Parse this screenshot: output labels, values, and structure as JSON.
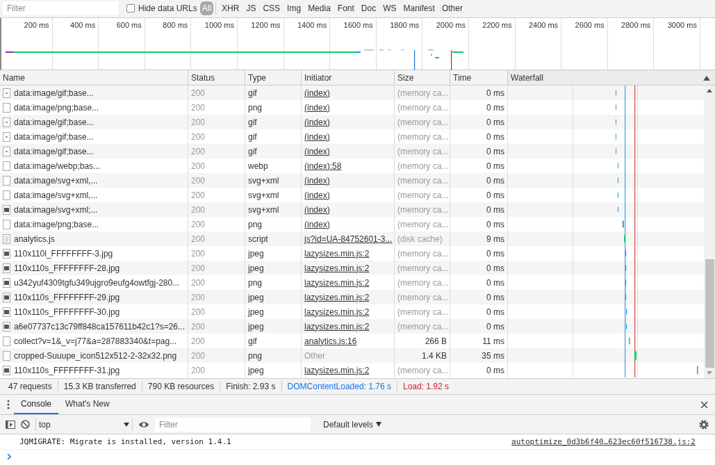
{
  "filter_bar": {
    "placeholder": "Filter",
    "hide_data_urls": {
      "label": "Hide data URLs",
      "checked": false
    },
    "type_filters": [
      {
        "label": "All",
        "selected": true
      },
      {
        "label": "XHR",
        "selected": false
      },
      {
        "label": "JS",
        "selected": false
      },
      {
        "label": "CSS",
        "selected": false
      },
      {
        "label": "Img",
        "selected": false
      },
      {
        "label": "Media",
        "selected": false
      },
      {
        "label": "Font",
        "selected": false
      },
      {
        "label": "Doc",
        "selected": false
      },
      {
        "label": "WS",
        "selected": false
      },
      {
        "label": "Manifest",
        "selected": false
      },
      {
        "label": "Other",
        "selected": false
      }
    ]
  },
  "overview": {
    "ticks": [
      "200 ms",
      "400 ms",
      "600 ms",
      "800 ms",
      "1000 ms",
      "1200 ms",
      "1400 ms",
      "1600 ms",
      "1800 ms",
      "2000 ms",
      "2200 ms",
      "2400 ms",
      "2600 ms",
      "2800 ms",
      "3000 ms"
    ]
  },
  "table": {
    "columns": [
      {
        "label": "Name",
        "sorted": false
      },
      {
        "label": "Status",
        "sorted": false
      },
      {
        "label": "Type",
        "sorted": false
      },
      {
        "label": "Initiator",
        "sorted": false
      },
      {
        "label": "Size",
        "sorted": false
      },
      {
        "label": "Time",
        "sorted": false
      },
      {
        "label": "Waterfall",
        "sorted": true
      }
    ],
    "rows": [
      {
        "kind": "dot",
        "name": "data:image/gif;base...",
        "status": "200",
        "type": "gif",
        "initiator": "(index)",
        "initiator_link": true,
        "size": "(memory ca...",
        "size_cached": true,
        "time": "0 ms"
      },
      {
        "kind": "blank",
        "name": "data:image/png;base...",
        "status": "200",
        "type": "png",
        "initiator": "(index)",
        "initiator_link": true,
        "size": "(memory ca...",
        "size_cached": true,
        "time": "0 ms"
      },
      {
        "kind": "dot",
        "name": "data:image/gif;base...",
        "status": "200",
        "type": "gif",
        "initiator": "(index)",
        "initiator_link": true,
        "size": "(memory ca...",
        "size_cached": true,
        "time": "0 ms"
      },
      {
        "kind": "dot",
        "name": "data:image/gif;base...",
        "status": "200",
        "type": "gif",
        "initiator": "(index)",
        "initiator_link": true,
        "size": "(memory ca...",
        "size_cached": true,
        "time": "0 ms"
      },
      {
        "kind": "dot",
        "name": "data:image/gif;base...",
        "status": "200",
        "type": "gif",
        "initiator": "(index)",
        "initiator_link": true,
        "size": "(memory ca...",
        "size_cached": true,
        "time": "0 ms"
      },
      {
        "kind": "blank",
        "name": "data:image/webp;bas...",
        "status": "200",
        "type": "webp",
        "initiator": "(index):58",
        "initiator_link": true,
        "size": "(memory ca...",
        "size_cached": true,
        "time": "0 ms"
      },
      {
        "kind": "blank",
        "name": "data:image/svg+xml,...",
        "status": "200",
        "type": "svg+xml",
        "initiator": "(index)",
        "initiator_link": true,
        "size": "(memory ca...",
        "size_cached": true,
        "time": "0 ms"
      },
      {
        "kind": "blank",
        "name": "data:image/svg+xml,...",
        "status": "200",
        "type": "svg+xml",
        "initiator": "(index)",
        "initiator_link": true,
        "size": "(memory ca...",
        "size_cached": true,
        "time": "0 ms"
      },
      {
        "kind": "thumb",
        "name": "data:image/svg+xml;...",
        "status": "200",
        "type": "svg+xml",
        "initiator": "(index)",
        "initiator_link": true,
        "size": "(memory ca...",
        "size_cached": true,
        "time": "0 ms"
      },
      {
        "kind": "blank",
        "name": "data:image/png;base...",
        "status": "200",
        "type": "png",
        "initiator": "(index)",
        "initiator_link": true,
        "size": "(memory ca...",
        "size_cached": true,
        "time": "0 ms"
      },
      {
        "kind": "doc",
        "name": "analytics.js",
        "status": "200",
        "type": "script",
        "initiator": "js?id=UA-84752601-3...",
        "initiator_link": true,
        "size": "(disk cache)",
        "size_cached": true,
        "time": "9 ms"
      },
      {
        "kind": "thumb",
        "name": "110x110l_FFFFFFFF-3.jpg",
        "status": "200",
        "type": "jpeg",
        "initiator": "lazysizes.min.js:2",
        "initiator_link": true,
        "size": "(memory ca...",
        "size_cached": true,
        "time": "0 ms"
      },
      {
        "kind": "thumb",
        "name": "110x110s_FFFFFFFF-28.jpg",
        "status": "200",
        "type": "jpeg",
        "initiator": "lazysizes.min.js:2",
        "initiator_link": true,
        "size": "(memory ca...",
        "size_cached": true,
        "time": "0 ms"
      },
      {
        "kind": "thumb",
        "name": "u342yuf4309tgfu349ujgro9eufg4owtfgj-280...",
        "status": "200",
        "type": "png",
        "initiator": "lazysizes.min.js:2",
        "initiator_link": true,
        "size": "(memory ca...",
        "size_cached": true,
        "time": "0 ms"
      },
      {
        "kind": "thumb",
        "name": "110x110s_FFFFFFFF-29.jpg",
        "status": "200",
        "type": "jpeg",
        "initiator": "lazysizes.min.js:2",
        "initiator_link": true,
        "size": "(memory ca...",
        "size_cached": true,
        "time": "0 ms"
      },
      {
        "kind": "thumb",
        "name": "110x110s_FFFFFFFF-30.jpg",
        "status": "200",
        "type": "jpeg",
        "initiator": "lazysizes.min.js:2",
        "initiator_link": true,
        "size": "(memory ca...",
        "size_cached": true,
        "time": "0 ms"
      },
      {
        "kind": "thumb",
        "name": "a6e07737c13c79ff848ca157611b42c1?s=26...",
        "status": "200",
        "type": "jpeg",
        "initiator": "lazysizes.min.js:2",
        "initiator_link": true,
        "size": "(memory ca...",
        "size_cached": true,
        "time": "0 ms"
      },
      {
        "kind": "blank",
        "name": "collect?v=1&_v=j77&a=287883340&t=pag...",
        "status": "200",
        "type": "gif",
        "initiator": "analytics.js:16",
        "initiator_link": true,
        "size": "266 B",
        "size_cached": false,
        "time": "11 ms"
      },
      {
        "kind": "blank",
        "name": "cropped-Suuupe_icon512x512-2-32x32.png",
        "status": "200",
        "type": "png",
        "initiator": "Other",
        "initiator_link": false,
        "size": "1.4 KB",
        "size_cached": false,
        "time": "35 ms"
      },
      {
        "kind": "thumb",
        "name": "110x110s_FFFFFFFF-31.jpg",
        "status": "200",
        "type": "jpeg",
        "initiator": "lazysizes.min.js:2",
        "initiator_link": true,
        "size": "(memory ca...",
        "size_cached": true,
        "time": "0 ms"
      }
    ]
  },
  "status_bar": [
    {
      "text": "47 requests",
      "color": "#333333"
    },
    {
      "text": "15.3 KB transferred",
      "color": "#333333"
    },
    {
      "text": "790 KB resources",
      "color": "#333333"
    },
    {
      "text": "Finish: 2.93 s",
      "color": "#333333"
    },
    {
      "text": "DOMContentLoaded: 1.76 s",
      "color": "#1a73e8"
    },
    {
      "text": "Load: 1.92 s",
      "color": "#c5221f"
    }
  ],
  "drawer": {
    "tabs": [
      {
        "label": "Console",
        "selected": true
      },
      {
        "label": "What's New",
        "selected": false
      }
    ],
    "context": "top",
    "filter_placeholder": "Filter",
    "levels": "Default levels",
    "messages": [
      {
        "text": "JQMIGRATE: Migrate is installed, version 1.4.1",
        "source": "autoptimize_0d3b6f40…623ec60f516738.js:2"
      }
    ]
  }
}
